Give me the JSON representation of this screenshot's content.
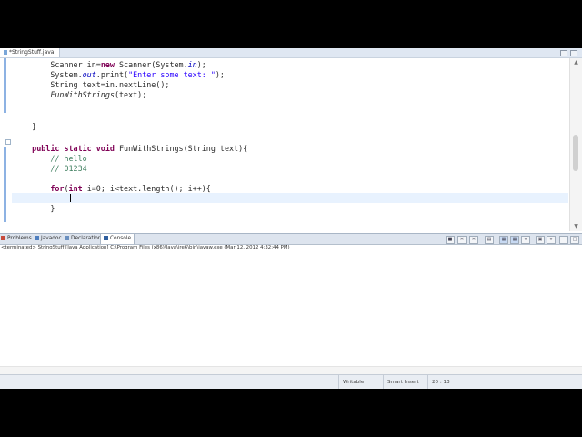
{
  "editor_tab": {
    "label": "*StringStuff.java"
  },
  "code": {
    "lines": [
      {
        "cls": "",
        "html": "        Scanner in=<span class=\"kw\">new</span> Scanner(System.<span class=\"fd\">in</span>);"
      },
      {
        "cls": "",
        "html": "        System.<span class=\"fd\">out</span>.print(<span class=\"str\">\"Enter some text: \"</span>);"
      },
      {
        "cls": "",
        "html": "        String text=in.nextLine();"
      },
      {
        "cls": "",
        "html": "        <span class=\"it\">FunWithStrings</span>(text);"
      },
      {
        "cls": "",
        "html": ""
      },
      {
        "cls": "",
        "html": ""
      },
      {
        "cls": "",
        "html": "    }"
      },
      {
        "cls": "",
        "html": ""
      },
      {
        "cls": "",
        "html": "    <span class=\"kw\">public static void</span> FunWithStrings(String text){"
      },
      {
        "cls": "",
        "html": "        <span class=\"cm\">// hello</span>"
      },
      {
        "cls": "",
        "html": "        <span class=\"cm\">// 01234</span>"
      },
      {
        "cls": "",
        "html": ""
      },
      {
        "cls": "",
        "html": "        <span class=\"kw\">for</span>(<span class=\"kw\">int</span> i=0; i&lt;text.length(); i++){"
      },
      {
        "cls": "",
        "html": ""
      },
      {
        "cls": "",
        "html": "        }"
      }
    ]
  },
  "views": {
    "tabs": [
      {
        "label": "Problems",
        "icon": "problems-icon",
        "color": "#c74b3c"
      },
      {
        "label": "Javadoc",
        "icon": "javadoc-icon",
        "color": "#4f7fbf"
      },
      {
        "label": "Declaration",
        "icon": "declaration-icon",
        "color": "#6a8fbf"
      },
      {
        "label": "Console",
        "icon": "console-icon",
        "color": "#2f5f9f",
        "active": true
      }
    ],
    "console_info": "<terminated> StringStuff [Java Application] C:\\Program Files (x86)\\Java\\jre6\\bin\\javaw.exe (Mar 12, 2012 4:32:44 PM)"
  },
  "status": {
    "writable": "Writable",
    "insert_mode": "Smart Insert",
    "position": "20 : 13"
  }
}
